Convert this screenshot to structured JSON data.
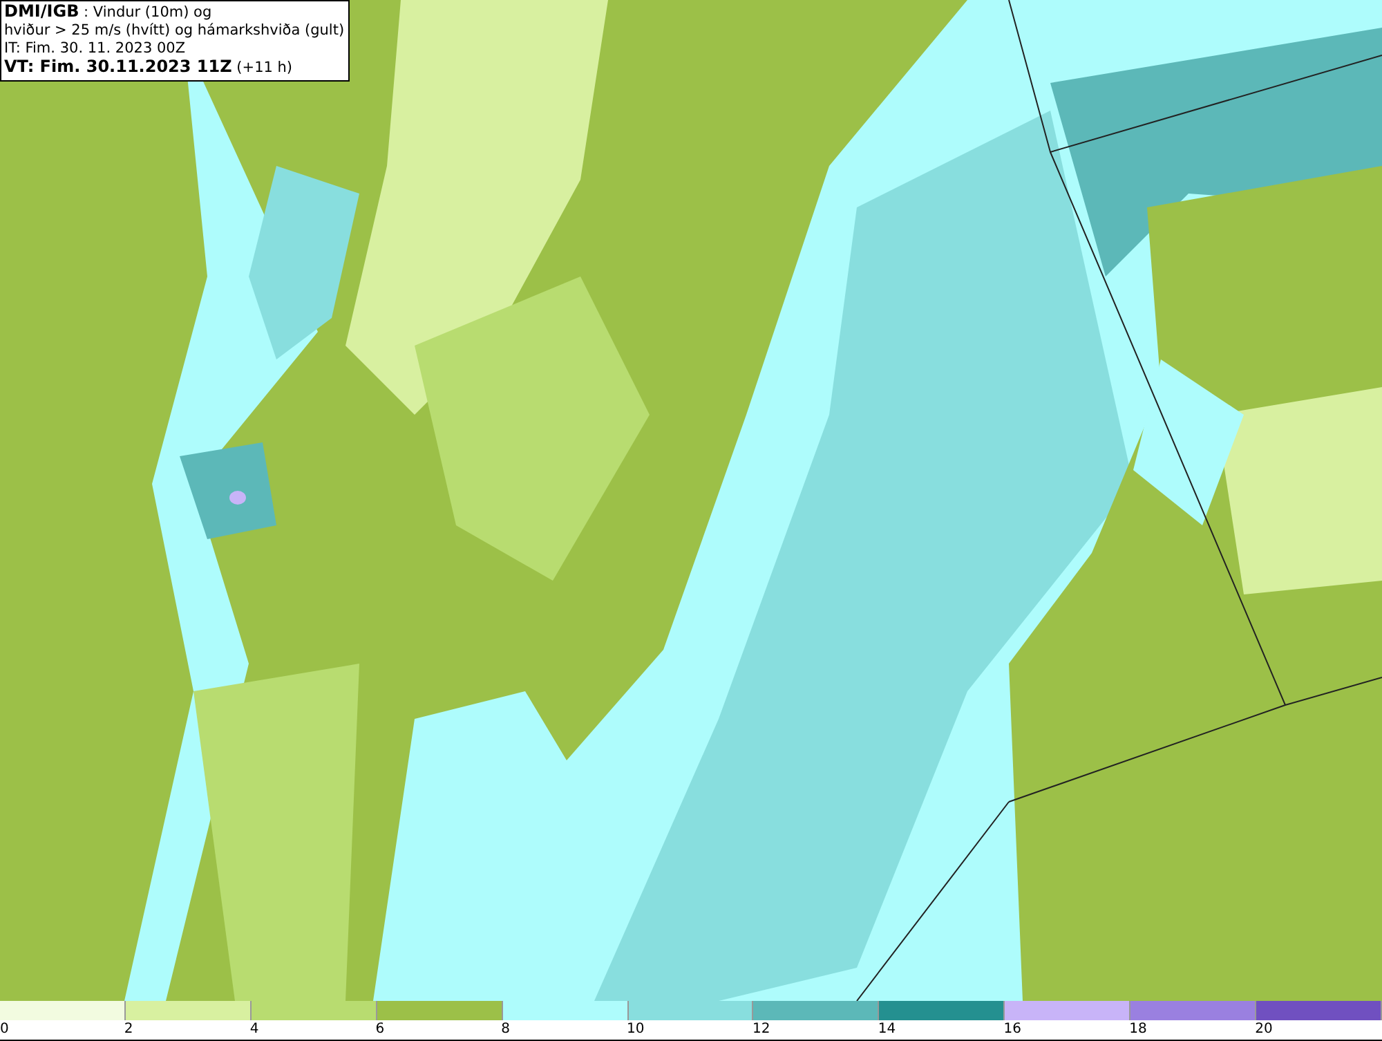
{
  "title_box": {
    "lines": [
      "**DMI/IGB** : Vindur (10m) og",
      "hviður > 25 m/s (hvítt) og hámarkshviða (gult)",
      "IT: Fim. 30. 11. 2023 00Z",
      "**VT: Fim. 30.11.2023 11Z** (+11 h)"
    ]
  },
  "legend": {
    "bins": [
      {
        "label": "0",
        "color": "#f2fbe0"
      },
      {
        "label": "2",
        "color": "#d8f0a0"
      },
      {
        "label": "4",
        "color": "#b8dc70"
      },
      {
        "label": "6",
        "color": "#9cc048"
      },
      {
        "label": "8",
        "color": "#aefcfc"
      },
      {
        "label": "10",
        "color": "#88dede"
      },
      {
        "label": "12",
        "color": "#5cb8b8"
      },
      {
        "label": "14",
        "color": "#249090"
      },
      {
        "label": "16",
        "color": "#c8b4f8"
      },
      {
        "label": "18",
        "color": "#9a80e0"
      },
      {
        "label": "20",
        "color": "#7050c0"
      }
    ]
  }
}
